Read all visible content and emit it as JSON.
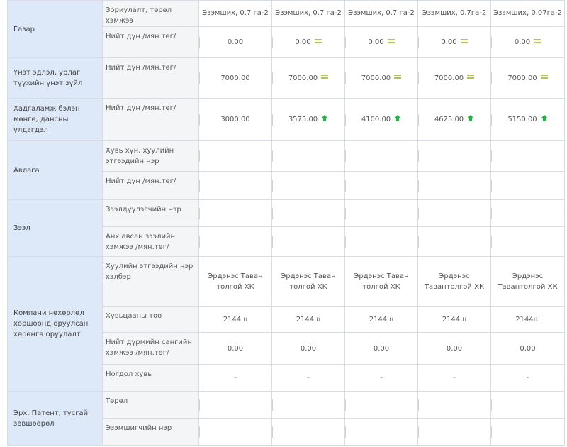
{
  "categories": {
    "land": "Газар",
    "valuables": "Үнэт эдлэл, урлаг түүхийн үнэт зүйл",
    "savings": "Хадгаламж бэлэн мөнгө, дансны үлдэгдэл",
    "receivables": "Авлага",
    "loans": "Зээл",
    "company": "Компани нөхөрлөл хоршоонд оруулсан хөрөнгө оруулалт",
    "rights": "Эрх, Патент, тусгай зөвшөөрөл"
  },
  "fields": {
    "purpose_type_size": "Зориулалт, төрөл хэмжээ",
    "total_amount": "Нийт дүн /мян.төг/",
    "person_name": "Хувь хүн, хуулийн этгээдийн нэр",
    "lender_name": "Зээлдүүлэгчийн нэр",
    "initial_loan_size": "Анх авсан зээлийн хэмжээ /мян.төг/",
    "legal_entity_form": "Хуулийн этгээдийн нэр хэлбэр",
    "share_count": "Хувьцааны тоо",
    "total_charter_fund": "Нийт дүрмийн сангийн хэмжээ /мян.төг/",
    "share_percent": "Ногдол хувь",
    "type": "Төрөл",
    "owner_name": "Эзэмшигчийн нэр"
  },
  "icons": {
    "unchanged": "equal-icon",
    "increase": "arrow-up-icon",
    "unchanged_color": "#b5c451",
    "increase_color": "#27b24a",
    "category_bg": "#dde9f8"
  },
  "land_purpose": [
    "Эзэмших, 0.7 га-2",
    "Эзэмших, 0.7 га-2",
    "Эзэмших, 0.7 га-2",
    "Эзэмших, 0.7га-2",
    "Эзэмших, 0.07га-2"
  ],
  "land_total": [
    "0.00",
    "0.00",
    "0.00",
    "0.00",
    "0.00"
  ],
  "valuables_total": [
    "7000.00",
    "7000.00",
    "7000.00",
    "7000.00",
    "7000.00"
  ],
  "savings_total": [
    "3000.00",
    "3575.00",
    "4100.00",
    "4625.00",
    "5150.00"
  ],
  "company_name": [
    "Эрдэнэс Таван толгой ХК",
    "Эрдэнэс Таван толгой ХК",
    "Эрдэнэс Таван толгой ХК",
    "Эрдэнэс Тавантолгой ХК",
    "Эрдэнэс Тавантолгой ХК"
  ],
  "share_count": [
    "2144ш",
    "2144ш",
    "2144ш",
    "2144ш",
    "2144ш"
  ],
  "charter_fund": [
    "0.00",
    "0.00",
    "0.00",
    "0.00",
    "0.00"
  ],
  "share_percent": [
    "-",
    "-",
    "-",
    "-",
    "-"
  ]
}
